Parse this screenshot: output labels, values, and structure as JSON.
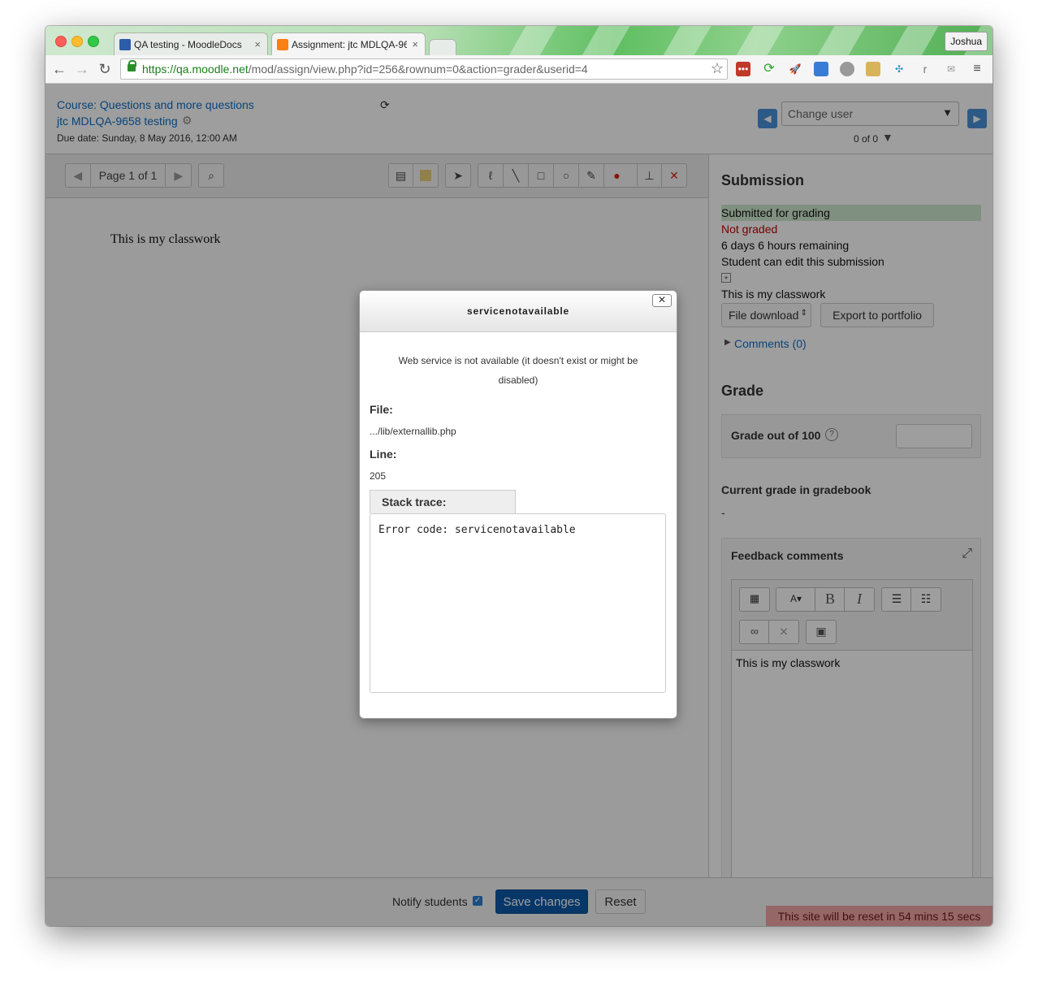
{
  "browser": {
    "tabs": [
      {
        "label": "QA testing - MoodleDocs",
        "close": "×"
      },
      {
        "label": "Assignment: jtc MDLQA-96",
        "close": "×"
      }
    ],
    "user_button": "Joshua",
    "url_host": "https://qa.moodle.net",
    "url_path": "/mod/assign/view.php?id=256&rownum=0&action=grader&userid=4"
  },
  "header": {
    "course_link": "Course: Questions and more questions",
    "assignment_link": "jtc MDLQA-9658 testing",
    "due_date": "Due date: Sunday, 8 May 2016, 12:00 AM",
    "change_user_placeholder": "Change user",
    "user_count": "0 of 0"
  },
  "viewer": {
    "page_label": "Page 1 of 1",
    "document_text": "This is my classwork"
  },
  "submission": {
    "heading": "Submission",
    "status_submitted": "Submitted for grading",
    "status_graded": "Not graded",
    "time_remaining": "6 days 6 hours remaining",
    "edit_status": "Student can edit this submission",
    "online_text": "This is my classwork",
    "file_download": "File download",
    "export_button": "Export to portfolio",
    "comments_link": "Comments (0)"
  },
  "grade": {
    "heading": "Grade",
    "grade_label": "Grade out of 100",
    "grade_value": "",
    "current_grade_label": "Current grade in gradebook",
    "current_grade_value": "-",
    "feedback_label": "Feedback comments",
    "feedback_text": "This is my classwork"
  },
  "footer": {
    "notify_label": "Notify students",
    "save_button": "Save changes",
    "reset_button": "Reset",
    "reset_banner": "This site will be reset in 54 mins 15 secs"
  },
  "modal": {
    "title": "servicenotavailable",
    "close": "✕",
    "message": "Web service is not available (it doesn't exist or might be disabled)",
    "file_label": "File:",
    "file_value": ".../lib/externallib.php",
    "line_label": "Line:",
    "line_value": "205",
    "stack_label": "Stack trace:",
    "stack_text": "Error code: servicenotavailable"
  },
  "colors": {
    "link": "#0f6fc5",
    "primary_button": "#0a5aa8",
    "not_graded": "#c00000",
    "submitted_bg": "#cfe8cf",
    "reset_banner_bg": "#f2a6a6"
  }
}
